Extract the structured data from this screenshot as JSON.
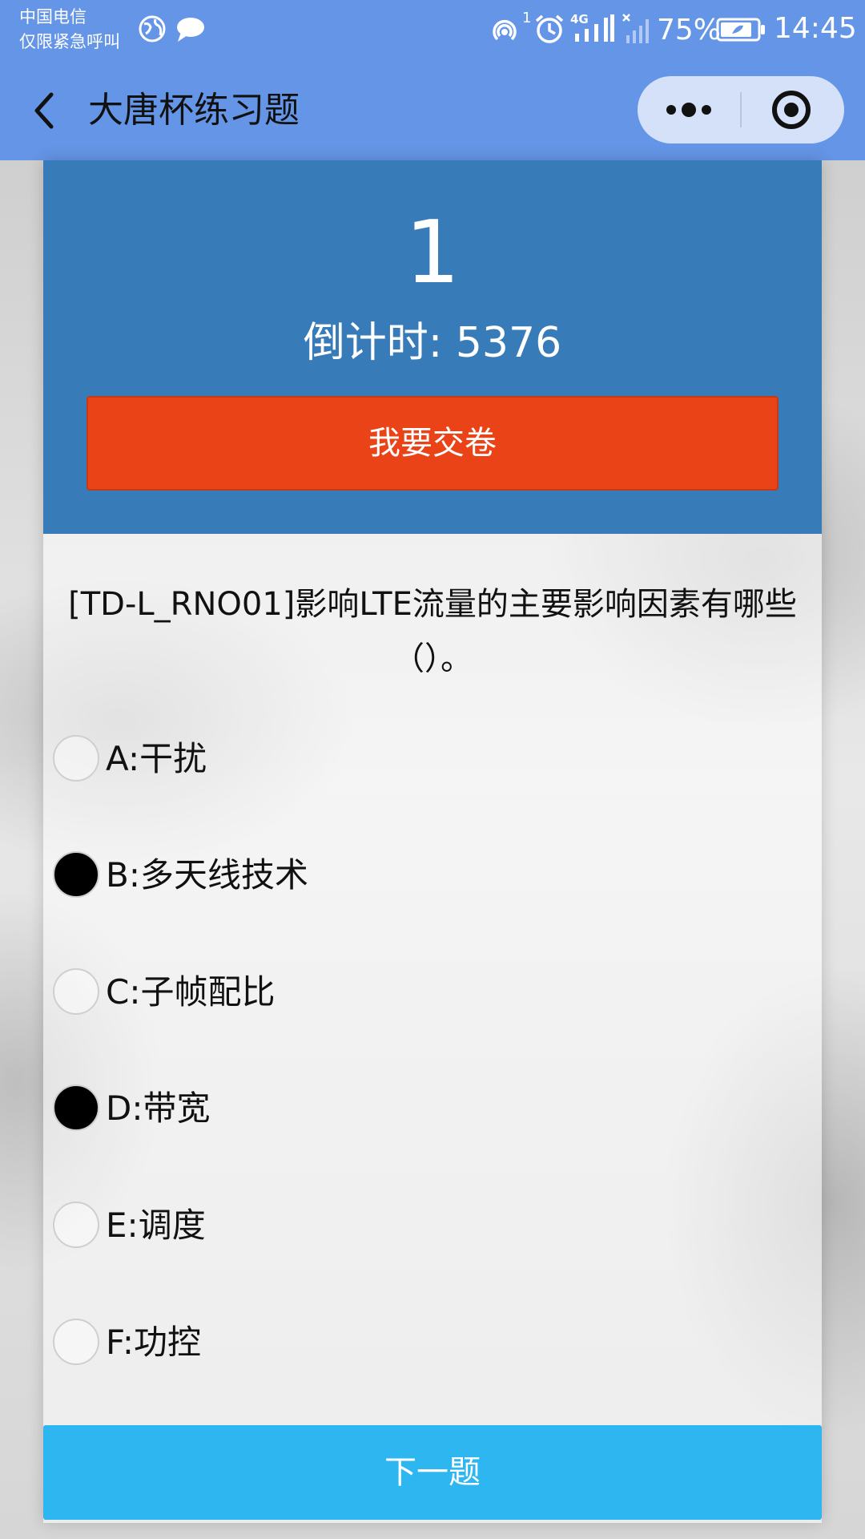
{
  "status_bar": {
    "carrier_line1": "中国电信",
    "carrier_line2": "仅限紧急呼叫",
    "hotspot_badge": "1",
    "network_label": "4G",
    "battery": "75%",
    "time": "14:45",
    "icons": [
      "globe-icon",
      "chat-bubble-icon",
      "hotspot-icon",
      "alarm-icon",
      "signal-icon",
      "no-signal-icon",
      "battery-icon"
    ]
  },
  "nav": {
    "title": "大唐杯练习题",
    "icons": [
      "back-arrow-icon",
      "more-dots-icon",
      "target-close-icon"
    ]
  },
  "quiz": {
    "question_number": "1",
    "countdown": "倒计时: 5376",
    "submit_label": "我要交卷",
    "question_text": "[TD-L_RNO01]影响LTE流量的主要影响因素有哪些（）。",
    "options": [
      {
        "label": "A:干扰",
        "checked": false
      },
      {
        "label": "B:多天线技术",
        "checked": true
      },
      {
        "label": "C:子帧配比",
        "checked": false
      },
      {
        "label": "D:带宽",
        "checked": true
      },
      {
        "label": "E:调度",
        "checked": false
      },
      {
        "label": "F:功控",
        "checked": false
      }
    ],
    "next_label": "下一题"
  },
  "colors": {
    "header_bar": "#6495e6",
    "panel_blue": "#377bb8",
    "submit_red": "#ea4318",
    "next_blue": "#2eb6f0"
  }
}
